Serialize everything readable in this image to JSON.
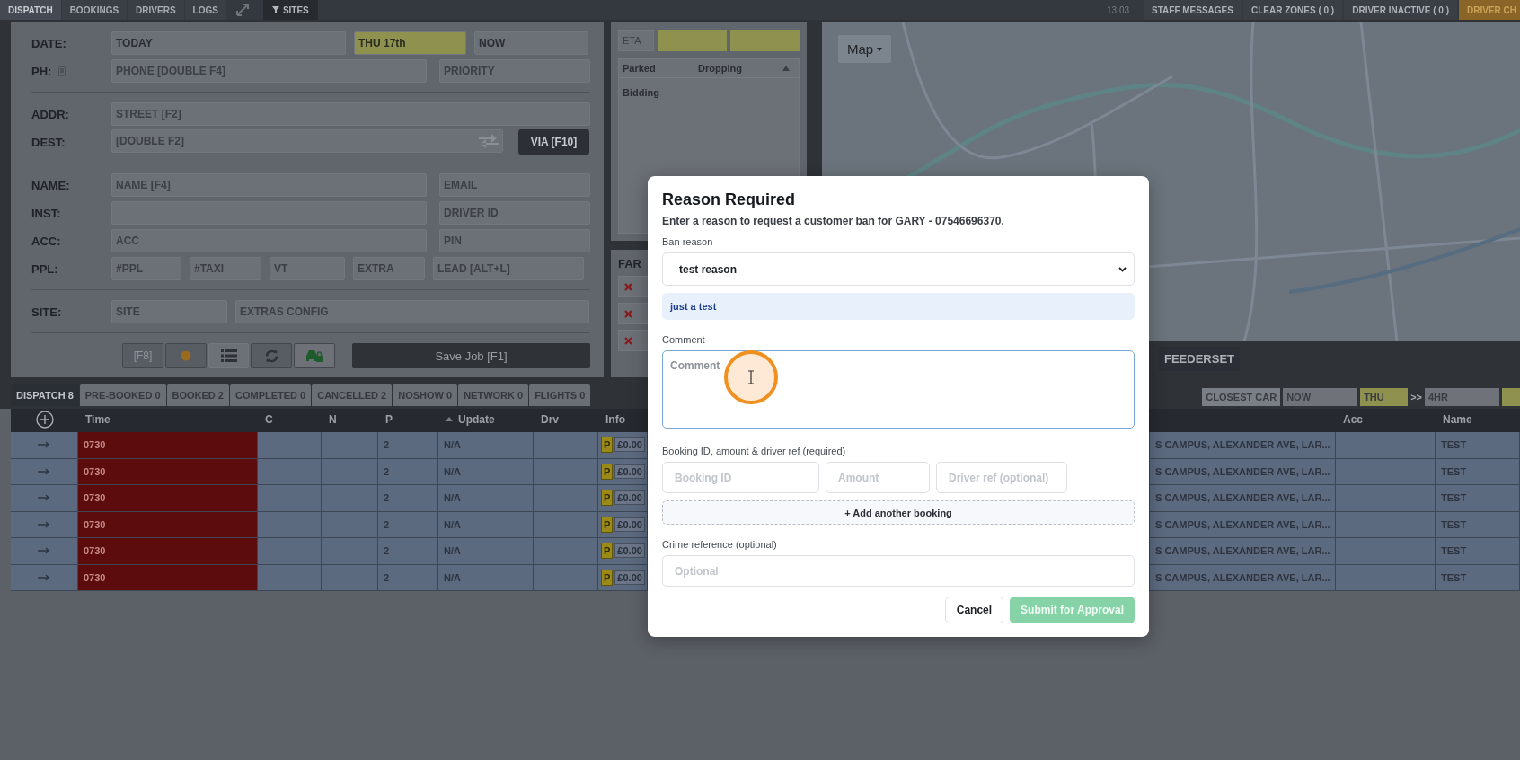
{
  "top_bar": {
    "tabs": [
      {
        "label": "DISPATCH",
        "selected": true
      },
      {
        "label": "BOOKINGS",
        "selected": false
      },
      {
        "label": "DRIVERS",
        "selected": false
      },
      {
        "label": "LOGS",
        "selected": false
      }
    ],
    "sites_button": "SITES",
    "time": "13:03",
    "buttons": [
      {
        "label": "STAFF MESSAGES",
        "kind": "plain"
      },
      {
        "label": "CLEAR ZONES ( 0 )",
        "kind": "plain"
      },
      {
        "label": "DRIVER INACTIVE ( 0 )",
        "kind": "plain"
      },
      {
        "label": "DRIVER CH",
        "kind": "alert"
      }
    ]
  },
  "job_form": {
    "sections": [
      [
        {
          "label": "DATE:",
          "kind": "date",
          "fields": [
            {
              "kind": "value",
              "text": "TODAY"
            },
            {
              "kind": "highlight",
              "text": "THU 17th"
            },
            {
              "kind": "value",
              "text": "NOW"
            }
          ]
        },
        {
          "label": "PH:",
          "kind": "phone",
          "fields": [
            {
              "kind": "input",
              "text": "PHONE [DOUBLE F4]"
            },
            {
              "kind": "input",
              "text": "PRIORITY"
            }
          ]
        }
      ],
      [
        {
          "label": "ADDR:",
          "kind": "wide",
          "fields": [
            {
              "kind": "input",
              "text": "STREET [F2]"
            }
          ]
        },
        {
          "label": "DEST:",
          "kind": "dest",
          "fields": [
            {
              "kind": "input",
              "text": "[DOUBLE F2]"
            }
          ],
          "button": "VIA [F10]"
        }
      ],
      [
        {
          "label": "NAME:",
          "kind": "pair",
          "fields": [
            {
              "kind": "input",
              "text": "NAME [F4]"
            },
            {
              "kind": "input",
              "text": "EMAIL"
            }
          ]
        },
        {
          "label": "INST:",
          "kind": "pair",
          "fields": [
            {
              "kind": "input"
            },
            {
              "kind": "input",
              "text": "DRIVER ID"
            }
          ]
        },
        {
          "label": "ACC:",
          "kind": "pair",
          "fields": [
            {
              "kind": "input",
              "text": "ACC"
            },
            {
              "kind": "input",
              "text": "PIN"
            }
          ]
        },
        {
          "label": "PPL:",
          "kind": "people",
          "fields": [
            {
              "kind": "input",
              "text": "#PPL"
            },
            {
              "kind": "input",
              "text": "#TAXI"
            },
            {
              "kind": "input",
              "text": "VT"
            },
            {
              "kind": "input",
              "text": "EXTRA"
            },
            {
              "kind": "input",
              "text": "LEAD [ALT+L]"
            }
          ]
        }
      ],
      [
        {
          "label": "SITE:",
          "kind": "site",
          "fields": [
            {
              "kind": "input",
              "text": "SITE"
            },
            {
              "kind": "input",
              "text": "EXTRAS CONFIG"
            }
          ]
        }
      ]
    ],
    "actions": [
      {
        "kind": "text",
        "label": "[F8]"
      },
      {
        "kind": "dot"
      },
      {
        "kind": "list"
      },
      {
        "kind": "refresh"
      },
      {
        "kind": "car"
      }
    ],
    "save_button": "Save Job [F1]"
  },
  "status_panel": {
    "eta_placeholder": "ETA",
    "columns": [
      "Parked",
      "Dropping"
    ],
    "rows": [
      "Bidding"
    ]
  },
  "fare_panel": {
    "title": "FAR",
    "rows": [
      {
        "kind": "remove"
      },
      {
        "kind": "remove"
      },
      {
        "kind": "remove"
      }
    ]
  },
  "map": {
    "menu_label": "Map",
    "buttons": [
      "FEEDERSET"
    ]
  },
  "dispatch": {
    "tabs": [
      {
        "label": "DISPATCH 8",
        "selected": true
      },
      {
        "label": "PRE-BOOKED 0",
        "selected": false
      },
      {
        "label": "BOOKED 2",
        "selected": false
      },
      {
        "label": "COMPLETED 0",
        "selected": false
      },
      {
        "label": "CANCELLED 2",
        "selected": false
      },
      {
        "label": "NOSHOW 0",
        "selected": false
      },
      {
        "label": "NETWORK 0",
        "selected": false
      },
      {
        "label": "FLIGHTS 0",
        "selected": false
      }
    ],
    "filters": {
      "closest_car": "CLOSEST CAR",
      "from": "NOW",
      "day": "THU",
      "separator": ">>",
      "to": "4HR"
    },
    "columns": [
      {
        "label": "Time",
        "sorted": false
      },
      {
        "label": "C",
        "sorted": false
      },
      {
        "label": "N",
        "sorted": false
      },
      {
        "label": "P",
        "sorted": false
      },
      {
        "label": "Update",
        "sorted": true
      },
      {
        "label": "Drv",
        "sorted": false
      },
      {
        "label": "Info",
        "sorted": false
      },
      {
        "label": "Acc",
        "sorted": false
      },
      {
        "label": "Name",
        "sorted": false
      }
    ],
    "rows": [
      {
        "time": "0730",
        "overdue": true,
        "p": "2",
        "update": "N/A",
        "flag": "P",
        "fare": "£0.00",
        "address": "S CAMPUS, ALEXANDER AVE, LAR...",
        "name": "TEST"
      },
      {
        "time": "0730",
        "overdue": true,
        "p": "2",
        "update": "N/A",
        "flag": "P",
        "fare": "£0.00",
        "address": "S CAMPUS, ALEXANDER AVE, LAR...",
        "name": "TEST"
      },
      {
        "time": "0730",
        "overdue": true,
        "p": "2",
        "update": "N/A",
        "flag": "P",
        "fare": "£0.00",
        "address": "S CAMPUS, ALEXANDER AVE, LAR...",
        "name": "TEST"
      },
      {
        "time": "0730",
        "overdue": true,
        "p": "2",
        "update": "N/A",
        "flag": "P",
        "fare": "£0.00",
        "address": "S CAMPUS, ALEXANDER AVE, LAR...",
        "name": "TEST"
      },
      {
        "time": "0730",
        "overdue": true,
        "p": "2",
        "update": "N/A",
        "flag": "P",
        "fare": "£0.00",
        "address": "S CAMPUS, ALEXANDER AVE, LAR...",
        "name": "TEST"
      },
      {
        "time": "0730",
        "overdue": true,
        "p": "2",
        "update": "N/A",
        "flag": "P",
        "fare": "£0.00",
        "address": "S CAMPUS, ALEXANDER AVE, LAR...",
        "name": "TEST"
      }
    ]
  },
  "modal": {
    "title": "Reason Required",
    "message": "Enter a reason to request a customer ban for GARY - 07546696370.",
    "ban_reason": {
      "label": "Ban reason",
      "value": "test reason"
    },
    "reason_note": "just a test",
    "comment": {
      "label": "Comment",
      "placeholder": "Comment"
    },
    "bookings": {
      "label": "Booking ID, amount & driver ref (required)",
      "fields": [
        {
          "placeholder": "Booking ID"
        },
        {
          "placeholder": "Amount"
        },
        {
          "placeholder": "Driver ref (optional)"
        }
      ],
      "add_button": "+ Add another booking"
    },
    "crime_reference": {
      "label": "Crime reference (optional)",
      "placeholder": "Optional"
    },
    "buttons": [
      {
        "label": "Cancel",
        "kind": "secondary",
        "disabled": false
      },
      {
        "label": "Submit for Approval",
        "kind": "primary",
        "disabled": true
      }
    ]
  }
}
